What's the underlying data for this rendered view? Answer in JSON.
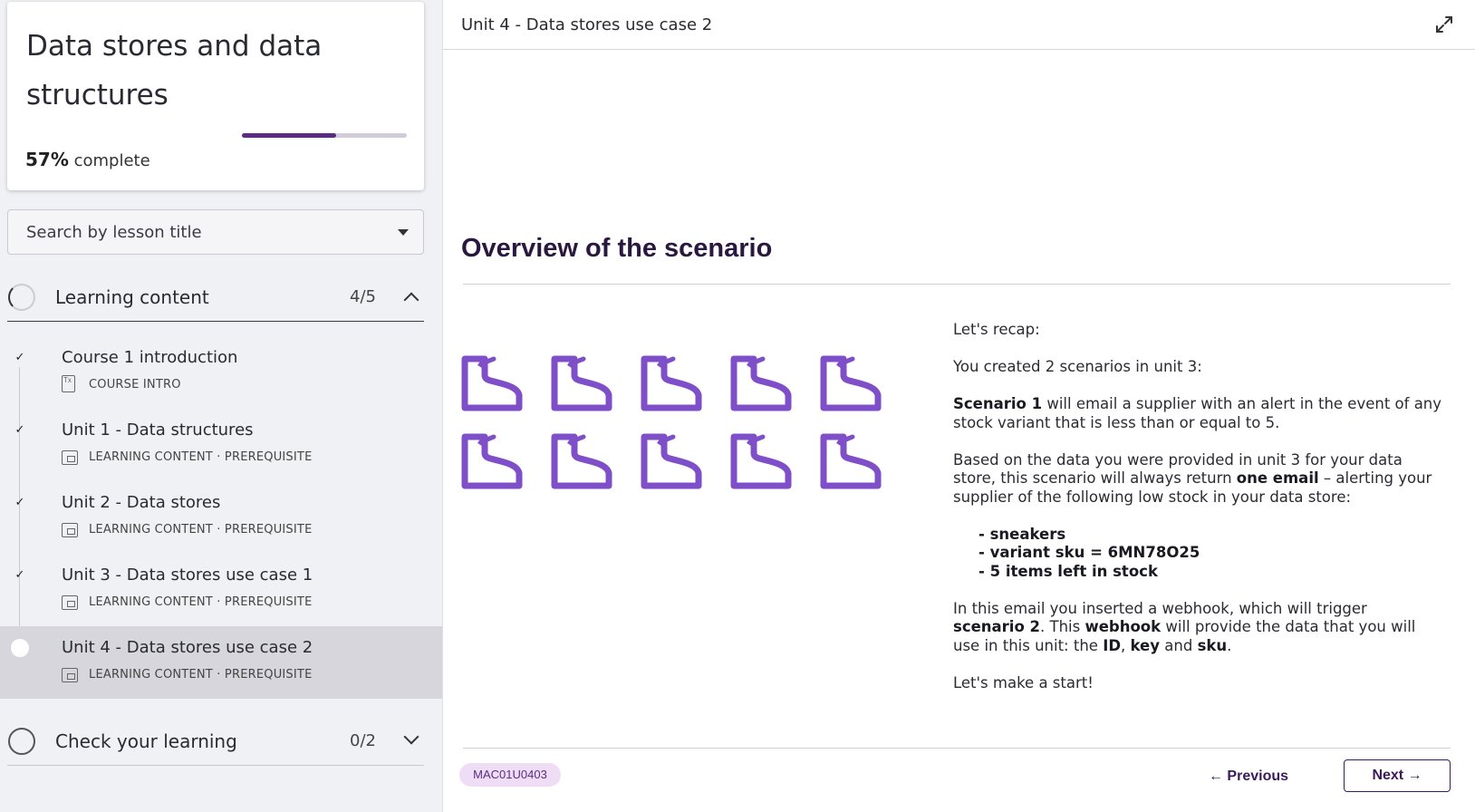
{
  "course": {
    "title": "Data stores and data structures",
    "progress_percent": 57,
    "progress_value": "57%",
    "progress_suffix": "complete"
  },
  "search": {
    "placeholder": "Search by lesson title"
  },
  "sections": [
    {
      "title": "Learning content",
      "count": "4/5",
      "expanded": true
    },
    {
      "title": "Check your learning",
      "count": "0/2",
      "expanded": false
    }
  ],
  "lessons": [
    {
      "title": "Course 1 introduction",
      "meta": "COURSE INTRO",
      "completed": true
    },
    {
      "title": "Unit 1 - Data structures",
      "meta": "LEARNING CONTENT · PREREQUISITE",
      "completed": true
    },
    {
      "title": "Unit 2 - Data stores",
      "meta": "LEARNING CONTENT · PREREQUISITE",
      "completed": true
    },
    {
      "title": "Unit 3 - Data stores use case 1",
      "meta": "LEARNING CONTENT · PREREQUISITE",
      "completed": true
    },
    {
      "title": "Unit 4 - Data stores use case 2",
      "meta": "LEARNING CONTENT · PREREQUISITE",
      "completed": false,
      "active": true
    }
  ],
  "main": {
    "unit_title": "Unit 4 - Data stores use case 2",
    "heading": "Overview of the scenario",
    "shoe_count": 10,
    "shoe_color": "#7f4fc9",
    "recap": "Let's recap:",
    "created": "You created 2 scenarios in unit 3:",
    "s1_bold": "Scenario 1",
    "s1_rest": " will email a supplier with an alert in the event of any stock variant that is less than or equal to 5.",
    "based_a": "Based on the data you were provided in unit 3 for your data store, this scenario will always return ",
    "based_bold": "one email",
    "based_b": " – alerting your supplier of the following low stock in your data store:",
    "list": [
      "- sneakers",
      "- variant sku = 6MN78O25",
      "- 5 items left in stock"
    ],
    "email_a": "In this email you inserted a webhook, which will trigger ",
    "email_bold1": "scenario 2",
    "email_b": ". This ",
    "email_bold2": "webhook",
    "email_c": " will provide the data that you will use in this unit: the ",
    "email_bold3": "ID",
    "email_d": ", ",
    "email_bold4": "key",
    "email_e": " and ",
    "email_bold5": "sku",
    "email_f": ".",
    "start": "Let's make a start!",
    "code": "MAC01U0403",
    "prev_label": "← Previous",
    "next_label": "Next →"
  },
  "colors": {
    "accent": "#5a2d82",
    "badge_bg": "#efdcf5",
    "active_row": "#d6d6dc"
  }
}
